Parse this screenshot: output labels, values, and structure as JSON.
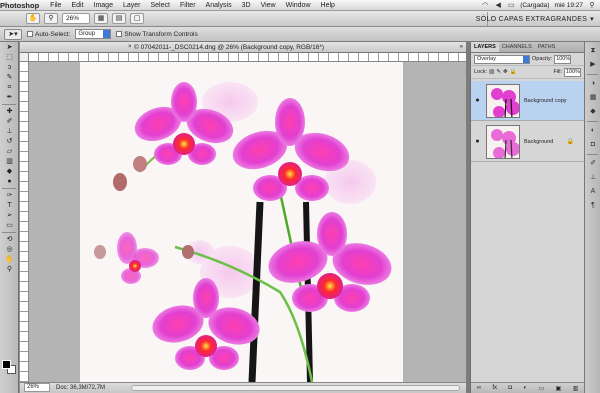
{
  "menubar": {
    "app_name": "Photoshop",
    "items": [
      "File",
      "Edit",
      "Image",
      "Layer",
      "Select",
      "Filter",
      "Analysis",
      "3D",
      "View",
      "Window",
      "Help"
    ],
    "battery": "(Cargada)",
    "clock": "mié 19:27"
  },
  "appbar": {
    "zoom": "26%",
    "workspace": "SÓLO CAPAS EXTRAGRANDES"
  },
  "options": {
    "auto_select_label": "Auto-Select:",
    "auto_select_value": "Group",
    "transform_label": "Show Transform Controls"
  },
  "document": {
    "tab_title": "© 07042011-_DSC0214.dng @ 26% (Background copy, RGB/16*)",
    "status_zoom": "26%",
    "status_doc": "Doc: 36,3M/72,7M"
  },
  "layers_panel": {
    "tabs": [
      "LAYERS",
      "CHANNELS",
      "PATHS"
    ],
    "blend_mode": "Overlay",
    "opacity_label": "Opacity:",
    "opacity_value": "100%",
    "lock_label": "Lock:",
    "fill_label": "Fill:",
    "fill_value": "100%",
    "layers": [
      {
        "name": "Background copy",
        "selected": true
      },
      {
        "name": "Background",
        "selected": false
      }
    ]
  },
  "colors": {
    "selected_layer": "#b9d2f0",
    "orchid": "#e23fd0"
  }
}
